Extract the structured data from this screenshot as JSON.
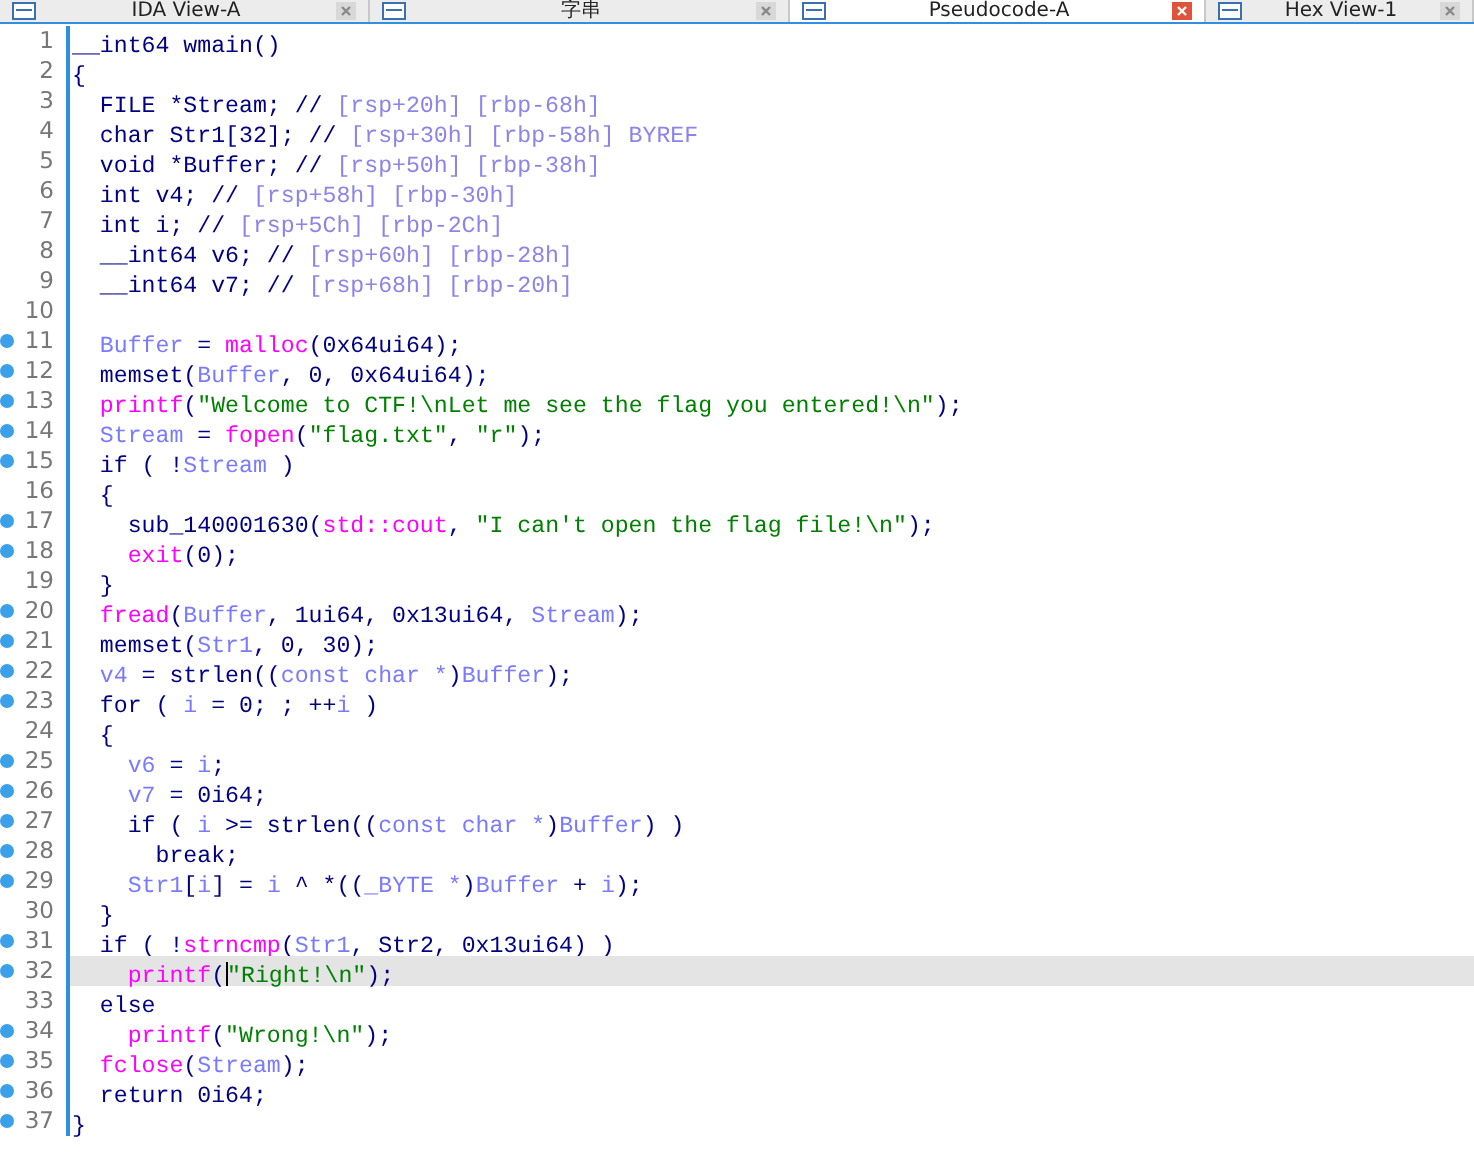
{
  "tabs": [
    {
      "label": "IDA View-A",
      "selected": false
    },
    {
      "label": "字串",
      "selected": false
    },
    {
      "label": "Pseudocode-A",
      "selected": true
    },
    {
      "label": "Hex View-1",
      "selected": false
    }
  ],
  "code": {
    "lines": [
      {
        "number": "1",
        "dot": false,
        "highlighted": false,
        "tokens": [
          {
            "kind": "plain",
            "text": "__int64 wmain()"
          }
        ]
      },
      {
        "number": "2",
        "dot": false,
        "highlighted": false,
        "tokens": [
          {
            "kind": "plain",
            "text": "{"
          }
        ]
      },
      {
        "number": "3",
        "dot": false,
        "highlighted": false,
        "tokens": [
          {
            "kind": "plain",
            "text": "  FILE *Stream; //"
          },
          {
            "kind": "comment",
            "text": " [rsp+20h] [rbp-68h]"
          }
        ]
      },
      {
        "number": "4",
        "dot": false,
        "highlighted": false,
        "tokens": [
          {
            "kind": "plain",
            "text": "  char Str1[32]; //"
          },
          {
            "kind": "comment",
            "text": " [rsp+30h] [rbp-58h] BYREF"
          }
        ]
      },
      {
        "number": "5",
        "dot": false,
        "highlighted": false,
        "tokens": [
          {
            "kind": "plain",
            "text": "  void *Buffer; //"
          },
          {
            "kind": "comment",
            "text": " [rsp+50h] [rbp-38h]"
          }
        ]
      },
      {
        "number": "6",
        "dot": false,
        "highlighted": false,
        "tokens": [
          {
            "kind": "plain",
            "text": "  int v4; //"
          },
          {
            "kind": "comment",
            "text": " [rsp+58h] [rbp-30h]"
          }
        ]
      },
      {
        "number": "7",
        "dot": false,
        "highlighted": false,
        "tokens": [
          {
            "kind": "plain",
            "text": "  int i; //"
          },
          {
            "kind": "comment",
            "text": " [rsp+5Ch] [rbp-2Ch]"
          }
        ]
      },
      {
        "number": "8",
        "dot": false,
        "highlighted": false,
        "tokens": [
          {
            "kind": "plain",
            "text": "  __int64 v6; //"
          },
          {
            "kind": "comment",
            "text": " [rsp+60h] [rbp-28h]"
          }
        ]
      },
      {
        "number": "9",
        "dot": false,
        "highlighted": false,
        "tokens": [
          {
            "kind": "plain",
            "text": "  __int64 v7; //"
          },
          {
            "kind": "comment",
            "text": " [rsp+68h] [rbp-20h]"
          }
        ]
      },
      {
        "number": "10",
        "dot": false,
        "highlighted": false
      },
      {
        "number": "11",
        "dot": true,
        "highlighted": false,
        "tokens": [
          {
            "kind": "variable",
            "text": "  Buffer"
          },
          {
            "kind": "plain",
            "text": " = "
          },
          {
            "kind": "function",
            "text": "malloc"
          },
          {
            "kind": "plain",
            "text": "(0x64ui64);"
          }
        ]
      },
      {
        "number": "12",
        "dot": true,
        "highlighted": false,
        "tokens": [
          {
            "kind": "plain",
            "text": "  memset("
          },
          {
            "kind": "variable",
            "text": "Buffer"
          },
          {
            "kind": "plain",
            "text": ", 0, 0x64ui64);"
          }
        ]
      },
      {
        "number": "13",
        "dot": true,
        "highlighted": false,
        "tokens": [
          {
            "kind": "function",
            "text": "  printf"
          },
          {
            "kind": "plain",
            "text": "("
          },
          {
            "kind": "string",
            "text": "\"Welcome to CTF!\\nLet me see the flag you entered!\\n\""
          },
          {
            "kind": "plain",
            "text": ");"
          }
        ]
      },
      {
        "number": "14",
        "dot": true,
        "highlighted": false,
        "tokens": [
          {
            "kind": "variable",
            "text": "  Stream"
          },
          {
            "kind": "plain",
            "text": " = "
          },
          {
            "kind": "function",
            "text": "fopen"
          },
          {
            "kind": "plain",
            "text": "("
          },
          {
            "kind": "string",
            "text": "\"flag.txt\""
          },
          {
            "kind": "plain",
            "text": ", "
          },
          {
            "kind": "string",
            "text": "\"r\""
          },
          {
            "kind": "plain",
            "text": ");"
          }
        ]
      },
      {
        "number": "15",
        "dot": true,
        "highlighted": false,
        "tokens": [
          {
            "kind": "plain",
            "text": "  if ( !"
          },
          {
            "kind": "variable",
            "text": "Stream"
          },
          {
            "kind": "plain",
            "text": " )"
          }
        ]
      },
      {
        "number": "16",
        "dot": false,
        "highlighted": false,
        "tokens": [
          {
            "kind": "plain",
            "text": "  {"
          }
        ]
      },
      {
        "number": "17",
        "dot": true,
        "highlighted": false,
        "tokens": [
          {
            "kind": "plain",
            "text": "    sub_140001630("
          },
          {
            "kind": "function",
            "text": "std::cout"
          },
          {
            "kind": "plain",
            "text": ", "
          },
          {
            "kind": "string",
            "text": "\"I can't open the flag file!\\n\""
          },
          {
            "kind": "plain",
            "text": ");"
          }
        ]
      },
      {
        "number": "18",
        "dot": true,
        "highlighted": false,
        "tokens": [
          {
            "kind": "function",
            "text": "    exit"
          },
          {
            "kind": "plain",
            "text": "(0);"
          }
        ]
      },
      {
        "number": "19",
        "dot": false,
        "highlighted": false,
        "tokens": [
          {
            "kind": "plain",
            "text": "  }"
          }
        ]
      },
      {
        "number": "20",
        "dot": true,
        "highlighted": false,
        "tokens": [
          {
            "kind": "function",
            "text": "  fread"
          },
          {
            "kind": "plain",
            "text": "("
          },
          {
            "kind": "variable",
            "text": "Buffer"
          },
          {
            "kind": "plain",
            "text": ", 1ui64, 0x13ui64, "
          },
          {
            "kind": "variable",
            "text": "Stream"
          },
          {
            "kind": "plain",
            "text": ");"
          }
        ]
      },
      {
        "number": "21",
        "dot": true,
        "highlighted": false,
        "tokens": [
          {
            "kind": "plain",
            "text": "  memset("
          },
          {
            "kind": "variable",
            "text": "Str1"
          },
          {
            "kind": "plain",
            "text": ", 0, 30);"
          }
        ]
      },
      {
        "number": "22",
        "dot": true,
        "highlighted": false,
        "tokens": [
          {
            "kind": "variable",
            "text": "  v4"
          },
          {
            "kind": "plain",
            "text": " = strlen(("
          },
          {
            "kind": "variable",
            "text": "const char *"
          },
          {
            "kind": "plain",
            "text": ")"
          },
          {
            "kind": "variable",
            "text": "Buffer"
          },
          {
            "kind": "plain",
            "text": ");"
          }
        ]
      },
      {
        "number": "23",
        "dot": true,
        "highlighted": false,
        "tokens": [
          {
            "kind": "plain",
            "text": "  for ( "
          },
          {
            "kind": "variable",
            "text": "i"
          },
          {
            "kind": "plain",
            "text": " = 0; ; ++"
          },
          {
            "kind": "variable",
            "text": "i"
          },
          {
            "kind": "plain",
            "text": " )"
          }
        ]
      },
      {
        "number": "24",
        "dot": false,
        "highlighted": false,
        "tokens": [
          {
            "kind": "plain",
            "text": "  {"
          }
        ]
      },
      {
        "number": "25",
        "dot": true,
        "highlighted": false,
        "tokens": [
          {
            "kind": "variable",
            "text": "    v6"
          },
          {
            "kind": "plain",
            "text": " = "
          },
          {
            "kind": "variable",
            "text": "i"
          },
          {
            "kind": "plain",
            "text": ";"
          }
        ]
      },
      {
        "number": "26",
        "dot": true,
        "highlighted": false,
        "tokens": [
          {
            "kind": "variable",
            "text": "    v7"
          },
          {
            "kind": "plain",
            "text": " = 0i64;"
          }
        ]
      },
      {
        "number": "27",
        "dot": true,
        "highlighted": false,
        "tokens": [
          {
            "kind": "plain",
            "text": "    if ( "
          },
          {
            "kind": "variable",
            "text": "i"
          },
          {
            "kind": "plain",
            "text": " >= strlen(("
          },
          {
            "kind": "variable",
            "text": "const char *"
          },
          {
            "kind": "plain",
            "text": ")"
          },
          {
            "kind": "variable",
            "text": "Buffer"
          },
          {
            "kind": "plain",
            "text": ") )"
          }
        ]
      },
      {
        "number": "28",
        "dot": true,
        "highlighted": false,
        "tokens": [
          {
            "kind": "plain",
            "text": "      break;"
          }
        ]
      },
      {
        "number": "29",
        "dot": true,
        "highlighted": false,
        "tokens": [
          {
            "kind": "variable",
            "text": "    Str1"
          },
          {
            "kind": "plain",
            "text": "["
          },
          {
            "kind": "variable",
            "text": "i"
          },
          {
            "kind": "plain",
            "text": "] = "
          },
          {
            "kind": "variable",
            "text": "i"
          },
          {
            "kind": "plain",
            "text": " ^ *(("
          },
          {
            "kind": "variable",
            "text": "_BYTE *"
          },
          {
            "kind": "plain",
            "text": ")"
          },
          {
            "kind": "variable",
            "text": "Buffer"
          },
          {
            "kind": "plain",
            "text": " + "
          },
          {
            "kind": "variable",
            "text": "i"
          },
          {
            "kind": "plain",
            "text": ");"
          }
        ]
      },
      {
        "number": "30",
        "dot": false,
        "highlighted": false,
        "tokens": [
          {
            "kind": "plain",
            "text": "  }"
          }
        ]
      },
      {
        "number": "31",
        "dot": true,
        "highlighted": false,
        "tokens": [
          {
            "kind": "plain",
            "text": "  if ( !"
          },
          {
            "kind": "function",
            "text": "strncmp"
          },
          {
            "kind": "plain",
            "text": "("
          },
          {
            "kind": "variable",
            "text": "Str1"
          },
          {
            "kind": "plain",
            "text": ", Str2, 0x13ui64) )"
          }
        ]
      },
      {
        "number": "32",
        "dot": true,
        "highlighted": true,
        "tokens": [
          {
            "kind": "function",
            "text": "    printf"
          },
          {
            "kind": "plain",
            "text": "("
          },
          {
            "kind": "string",
            "text": "\"Right!\\n\"",
            "cursor": true
          },
          {
            "kind": "plain",
            "text": ");"
          }
        ]
      },
      {
        "number": "33",
        "dot": false,
        "highlighted": false,
        "tokens": [
          {
            "kind": "plain",
            "text": "  else"
          }
        ]
      },
      {
        "number": "34",
        "dot": true,
        "highlighted": false,
        "tokens": [
          {
            "kind": "function",
            "text": "    printf"
          },
          {
            "kind": "plain",
            "text": "("
          },
          {
            "kind": "string",
            "text": "\"Wrong!\\n\""
          },
          {
            "kind": "plain",
            "text": ");"
          }
        ]
      },
      {
        "number": "35",
        "dot": true,
        "highlighted": false,
        "tokens": [
          {
            "kind": "function",
            "text": "  fclose"
          },
          {
            "kind": "plain",
            "text": "("
          },
          {
            "kind": "variable",
            "text": "Stream"
          },
          {
            "kind": "plain",
            "text": ");"
          }
        ]
      },
      {
        "number": "36",
        "dot": true,
        "highlighted": false,
        "tokens": [
          {
            "kind": "plain",
            "text": "  return 0i64;"
          }
        ]
      },
      {
        "number": "37",
        "dot": true,
        "highlighted": false,
        "tokens": [
          {
            "kind": "plain",
            "text": "}"
          }
        ]
      }
    ]
  }
}
